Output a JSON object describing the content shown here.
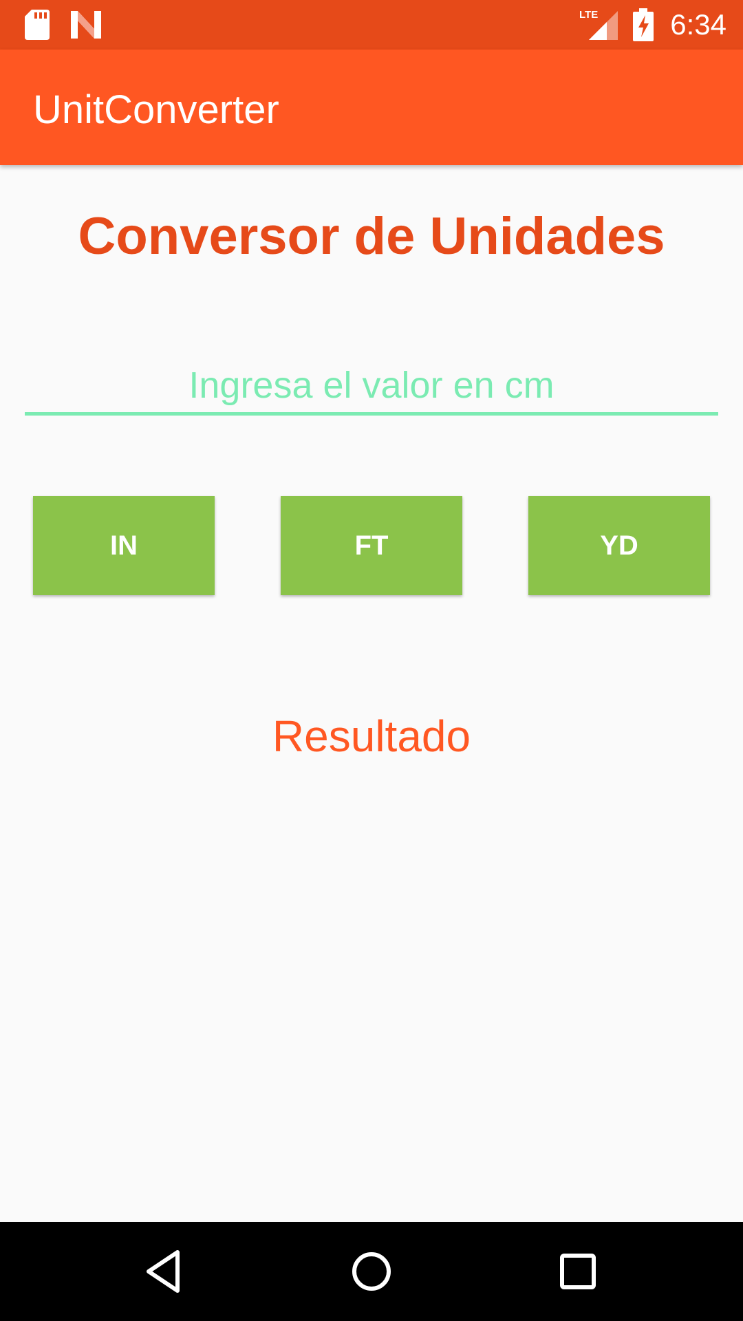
{
  "status_bar": {
    "time": "6:34",
    "network": "LTE",
    "icons": [
      "sd-card-icon",
      "n-notification-icon",
      "lte-signal-icon",
      "battery-charging-icon"
    ]
  },
  "app_bar": {
    "title": "UnitConverter"
  },
  "main": {
    "heading": "Conversor de Unidades",
    "input": {
      "value": "",
      "placeholder": "Ingresa el valor en cm"
    },
    "buttons": [
      {
        "label": "IN"
      },
      {
        "label": "FT"
      },
      {
        "label": "YD"
      }
    ],
    "result_text": "Resultado"
  },
  "nav_bar": {
    "icons": [
      "back-icon",
      "home-icon",
      "recents-icon"
    ]
  },
  "colors": {
    "status_bar": "#e64a19",
    "app_bar": "#ff5722",
    "heading": "#e64a19",
    "input_accent": "#7bebb2",
    "button": "#8bc34a",
    "result": "#ff5722"
  }
}
